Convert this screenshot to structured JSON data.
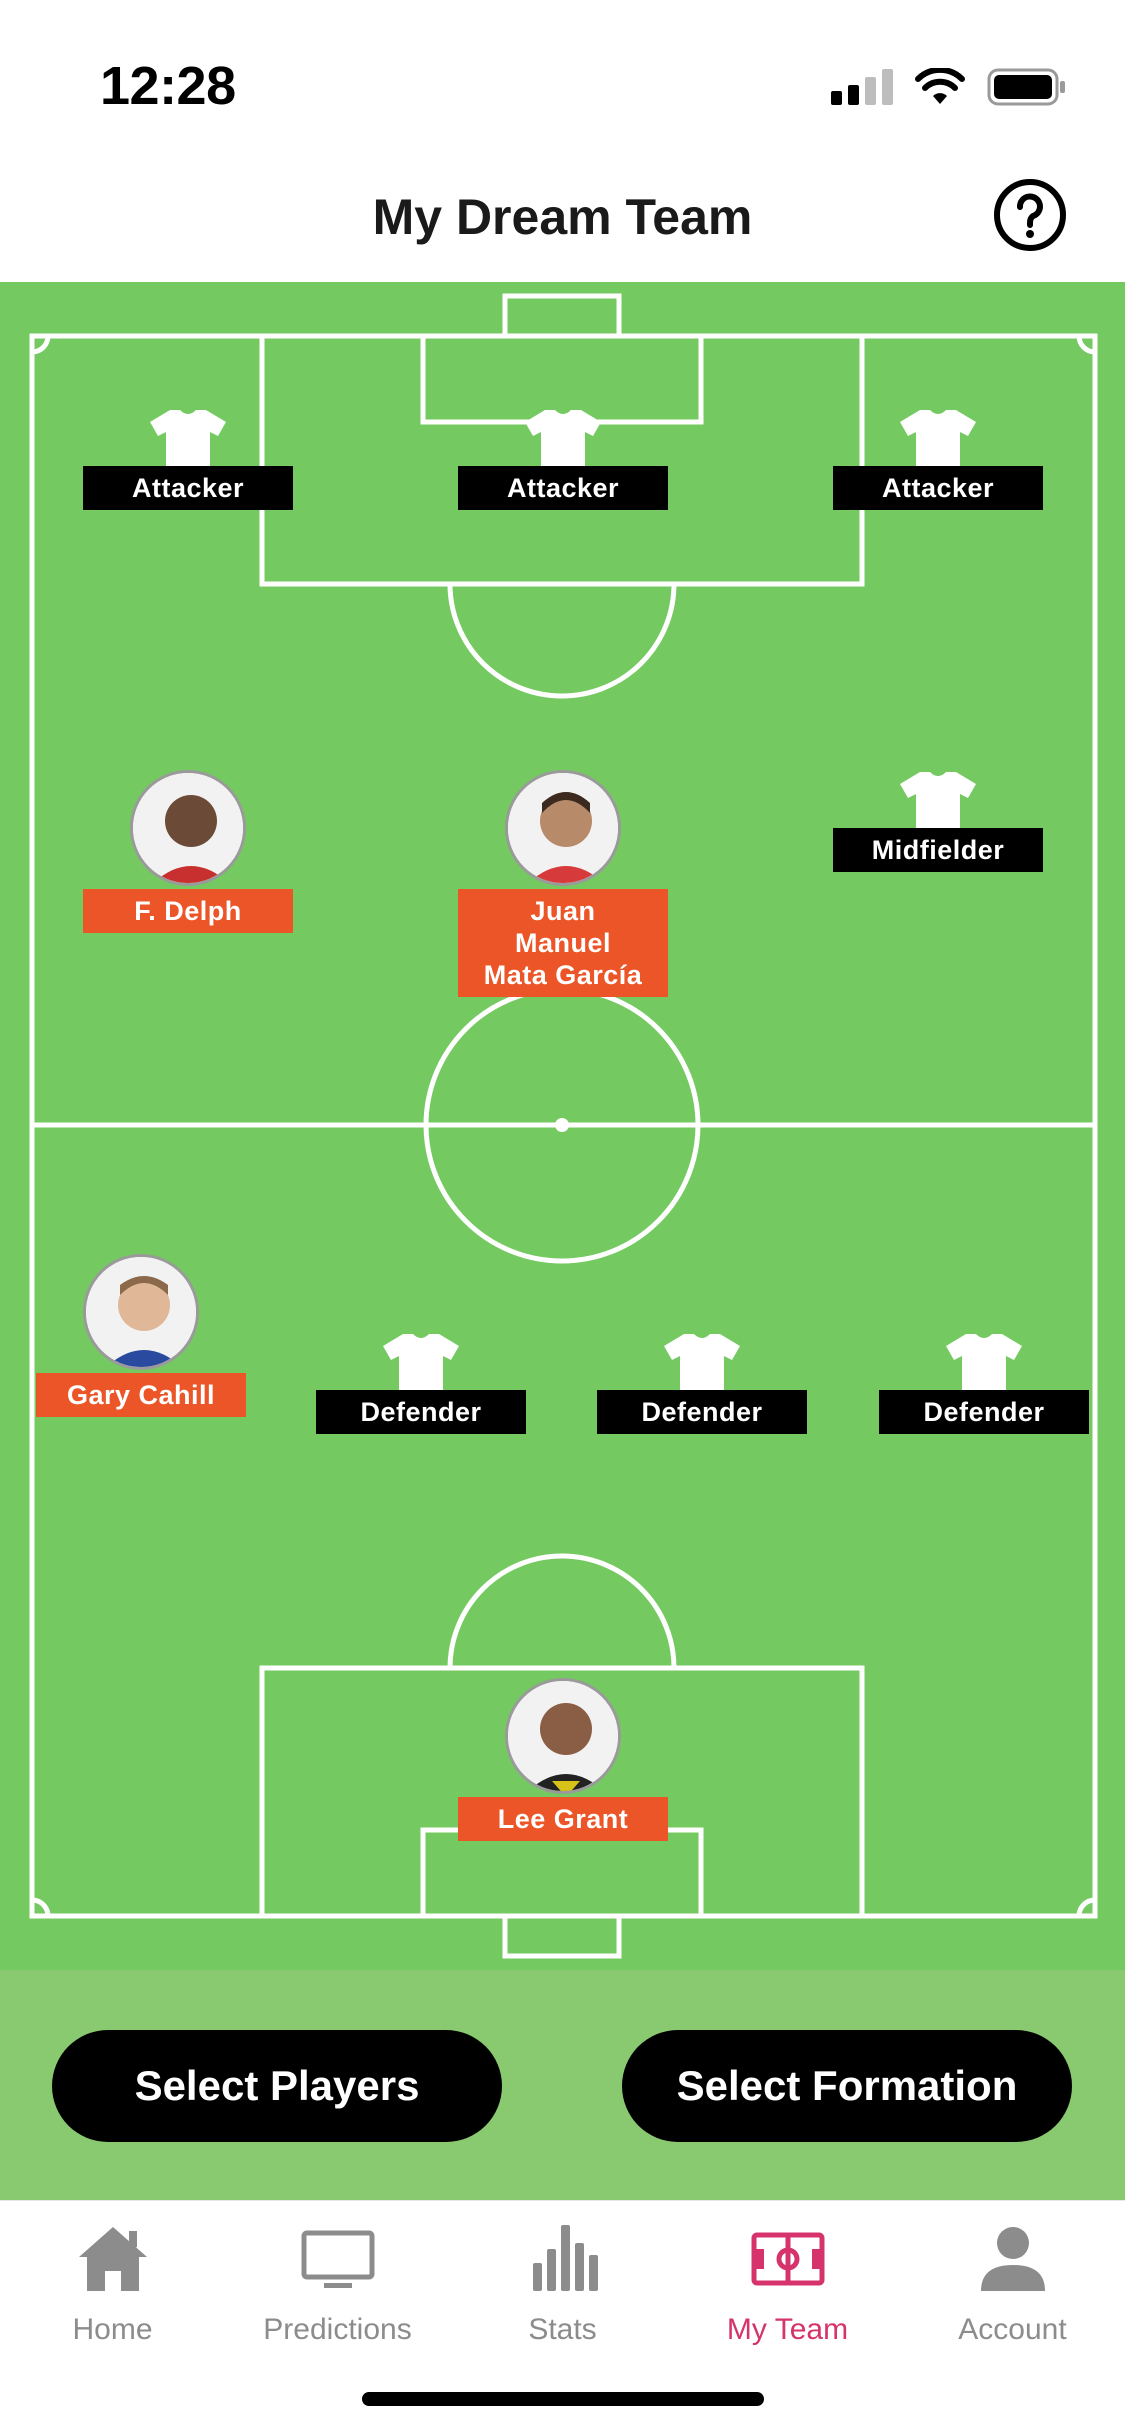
{
  "status": {
    "time": "12:28"
  },
  "header": {
    "title": "My Dream Team"
  },
  "pitch": {
    "attackers": [
      {
        "label": "Attacker"
      },
      {
        "label": "Attacker"
      },
      {
        "label": "Attacker"
      }
    ],
    "midfielders": [
      {
        "label": "F. Delph",
        "type": "player"
      },
      {
        "label": "Juan\nManuel\nMata García",
        "type": "player"
      },
      {
        "label": "Midfielder",
        "type": "empty"
      }
    ],
    "defenders": [
      {
        "label": "Gary Cahill",
        "type": "player"
      },
      {
        "label": "Defender",
        "type": "empty"
      },
      {
        "label": "Defender",
        "type": "empty"
      },
      {
        "label": "Defender",
        "type": "empty"
      }
    ],
    "goalkeeper": {
      "label": "Lee Grant",
      "type": "player"
    }
  },
  "actions": {
    "select_players": "Select Players",
    "select_formation": "Select Formation"
  },
  "tabs": [
    {
      "label": "Home",
      "icon": "home-icon"
    },
    {
      "label": "Predictions",
      "icon": "tv-icon"
    },
    {
      "label": "Stats",
      "icon": "bar-chart-icon"
    },
    {
      "label": "My Team",
      "icon": "pitch-icon",
      "active": true
    },
    {
      "label": "Account",
      "icon": "person-icon"
    }
  ],
  "colors": {
    "pitch": "#74c960",
    "player_tag": "#ec5527",
    "position_tag": "#000000",
    "active_tab": "#d6336c"
  }
}
